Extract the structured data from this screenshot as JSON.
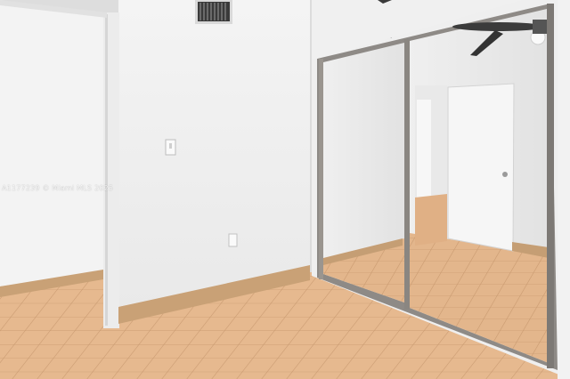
{
  "photo": {
    "watermark": "A1177239 © Miami MLS 2025",
    "colors": {
      "wall": "#f1f1f1",
      "wall_shadow": "#e4e4e4",
      "floor_tile": "#e6b98f",
      "floor_grout": "#c99a70",
      "baseboard": "#c9a176",
      "mirror_frame": "#8e8a86",
      "door": "#f6f6f6"
    }
  }
}
